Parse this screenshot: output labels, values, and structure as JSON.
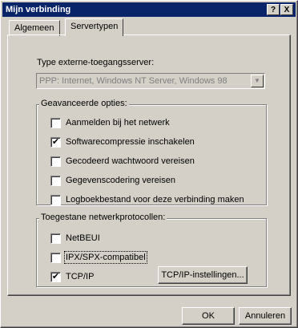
{
  "window": {
    "title": "Mijn verbinding",
    "help_btn": "?",
    "close_btn": "X"
  },
  "tabs": [
    "Algemeen",
    "Servertypen"
  ],
  "server": {
    "type_label": "Type externe-toegangsserver:",
    "selected": "PPP: Internet, Windows NT Server, Windows 98",
    "arrow": "▼"
  },
  "advanced": {
    "title": "Geavanceerde opties:",
    "options": [
      {
        "label": "Aanmelden bij het netwerk",
        "checked": false
      },
      {
        "label": "Softwarecompressie inschakelen",
        "checked": true
      },
      {
        "label": "Gecodeerd wachtwoord vereisen",
        "checked": false
      },
      {
        "label": "Gegevenscodering vereisen",
        "checked": false
      },
      {
        "label": "Logboekbestand voor deze verbinding maken",
        "checked": false
      }
    ]
  },
  "protocols": {
    "title": "Toegestane netwerkprotocollen:",
    "items": [
      {
        "label": "NetBEUI",
        "checked": false
      },
      {
        "label": "IPX/SPX-compatibel",
        "checked": false
      },
      {
        "label": "TCP/IP",
        "checked": true
      }
    ],
    "tcpip_button": "TCP/IP-instellingen..."
  },
  "footer": {
    "ok": "OK",
    "cancel": "Annuleren"
  },
  "check_glyph": "✔"
}
